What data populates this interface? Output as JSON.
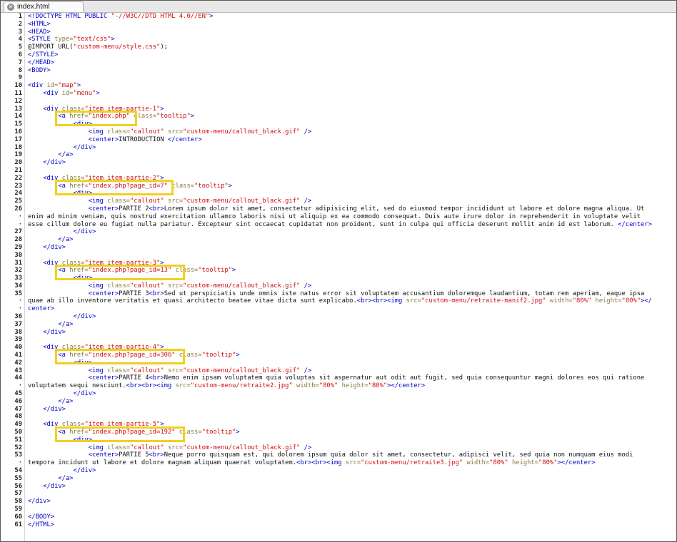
{
  "tab": {
    "label": "index.html",
    "close_icon": "close-circle-icon"
  },
  "colors": {
    "tag": "#0000c8",
    "attribute": "#8a7a3c",
    "string": "#d01010",
    "highlight": "#f0d020"
  },
  "lines": [
    {
      "n": "1",
      "c": [
        [
          "t",
          "<!DOCTYPE HTML PUBLIC "
        ],
        [
          "s",
          "\"-//W3C//DTD HTML 4.0//EN\""
        ],
        [
          "t",
          ">"
        ]
      ]
    },
    {
      "n": "2",
      "c": [
        [
          "t",
          "<HTML>"
        ]
      ]
    },
    {
      "n": "3",
      "c": [
        [
          "t",
          "<HEAD>"
        ]
      ]
    },
    {
      "n": "4",
      "c": [
        [
          "t",
          "<STYLE "
        ],
        [
          "a",
          "type="
        ],
        [
          "s",
          "\"text/css\""
        ],
        [
          "t",
          ">"
        ]
      ]
    },
    {
      "n": "5",
      "c": [
        [
          "x",
          "@IMPORT URL("
        ],
        [
          "s",
          "\"custom-menu/style.css\""
        ],
        [
          "x",
          ");"
        ]
      ]
    },
    {
      "n": "6",
      "c": [
        [
          "t",
          "</STYLE>"
        ]
      ]
    },
    {
      "n": "7",
      "c": [
        [
          "t",
          "</HEAD>"
        ]
      ]
    },
    {
      "n": "8",
      "c": [
        [
          "t",
          "<BODY>"
        ]
      ]
    },
    {
      "n": "9",
      "c": []
    },
    {
      "n": "10",
      "c": [
        [
          "t",
          "<div "
        ],
        [
          "a",
          "id="
        ],
        [
          "s",
          "\"map\""
        ],
        [
          "t",
          ">"
        ]
      ]
    },
    {
      "n": "11",
      "c": [
        [
          "x",
          "    "
        ],
        [
          "t",
          "<div "
        ],
        [
          "a",
          "id="
        ],
        [
          "s",
          "\"menu\""
        ],
        [
          "t",
          ">"
        ]
      ]
    },
    {
      "n": "12",
      "c": []
    },
    {
      "n": "13",
      "c": [
        [
          "x",
          "    "
        ],
        [
          "t",
          "<div "
        ],
        [
          "a",
          "class="
        ],
        [
          "s",
          "\"item item-partie-1\""
        ],
        [
          "t",
          ">"
        ]
      ]
    },
    {
      "n": "14",
      "c": [
        [
          "x",
          "        "
        ],
        [
          "t",
          "<a "
        ],
        [
          "a",
          "href="
        ],
        [
          "s",
          "\"index.php\""
        ],
        [
          "x",
          " "
        ],
        [
          "a",
          "class="
        ],
        [
          "s",
          "\"tooltip\""
        ],
        [
          "t",
          ">"
        ]
      ]
    },
    {
      "n": "15",
      "c": [
        [
          "x",
          "            "
        ],
        [
          "t",
          "<div>"
        ]
      ]
    },
    {
      "n": "16",
      "c": [
        [
          "x",
          "                "
        ],
        [
          "t",
          "<img "
        ],
        [
          "a",
          "class="
        ],
        [
          "s",
          "\"callout\""
        ],
        [
          "x",
          " "
        ],
        [
          "a",
          "src="
        ],
        [
          "s",
          "\"custom-menu/callout_black.gif\""
        ],
        [
          "x",
          " "
        ],
        [
          "t",
          "/>"
        ]
      ]
    },
    {
      "n": "17",
      "c": [
        [
          "x",
          "                "
        ],
        [
          "t",
          "<center>"
        ],
        [
          "x",
          "INTRODUCTION "
        ],
        [
          "t",
          "</center>"
        ]
      ]
    },
    {
      "n": "18",
      "c": [
        [
          "x",
          "            "
        ],
        [
          "t",
          "</div>"
        ]
      ]
    },
    {
      "n": "19",
      "c": [
        [
          "x",
          "        "
        ],
        [
          "t",
          "</a>"
        ]
      ]
    },
    {
      "n": "20",
      "c": [
        [
          "x",
          "    "
        ],
        [
          "t",
          "</div>"
        ]
      ]
    },
    {
      "n": "21",
      "c": []
    },
    {
      "n": "22",
      "c": [
        [
          "x",
          "    "
        ],
        [
          "t",
          "<div "
        ],
        [
          "a",
          "class="
        ],
        [
          "s",
          "\"item item-partie-2\""
        ],
        [
          "t",
          ">"
        ]
      ]
    },
    {
      "n": "23",
      "c": [
        [
          "x",
          "        "
        ],
        [
          "t",
          "<a "
        ],
        [
          "a",
          "href="
        ],
        [
          "s",
          "\"index.php?page_id=7\""
        ],
        [
          "x",
          " "
        ],
        [
          "a",
          "class="
        ],
        [
          "s",
          "\"tooltip\""
        ],
        [
          "t",
          ">"
        ]
      ]
    },
    {
      "n": "24",
      "c": [
        [
          "x",
          "            "
        ],
        [
          "t",
          "<div>"
        ]
      ]
    },
    {
      "n": "25",
      "c": [
        [
          "x",
          "                "
        ],
        [
          "t",
          "<img "
        ],
        [
          "a",
          "class="
        ],
        [
          "s",
          "\"callout\""
        ],
        [
          "x",
          " "
        ],
        [
          "a",
          "src="
        ],
        [
          "s",
          "\"custom-menu/callout_black.gif\""
        ],
        [
          "x",
          " "
        ],
        [
          "t",
          "/>"
        ]
      ]
    },
    {
      "n": "26",
      "c": [
        [
          "x",
          "                "
        ],
        [
          "t",
          "<center>"
        ],
        [
          "x",
          "PARTIE 2"
        ],
        [
          "t",
          "<br>"
        ],
        [
          "x",
          "Lorem ipsum dolor sit amet, consectetur adipisicing elit, sed do eiusmod tempor incididunt ut labore et dolore magna aliqua. Ut"
        ]
      ]
    },
    {
      "n": "·",
      "c": [
        [
          "x",
          "enim ad minim veniam, quis nostrud exercitation ullamco laboris nisi ut aliquip ex ea commodo consequat. Duis aute irure dolor in reprehenderit in voluptate velit"
        ]
      ]
    },
    {
      "n": "·",
      "c": [
        [
          "x",
          "esse cillum dolore eu fugiat nulla pariatur. Excepteur sint occaecat cupidatat non proident, sunt in culpa qui officia deserunt mollit anim id est laborum. "
        ],
        [
          "t",
          "</center>"
        ]
      ]
    },
    {
      "n": "27",
      "c": [
        [
          "x",
          "            "
        ],
        [
          "t",
          "</div>"
        ]
      ]
    },
    {
      "n": "28",
      "c": [
        [
          "x",
          "        "
        ],
        [
          "t",
          "</a>"
        ]
      ]
    },
    {
      "n": "29",
      "c": [
        [
          "x",
          "    "
        ],
        [
          "t",
          "</div>"
        ]
      ]
    },
    {
      "n": "30",
      "c": []
    },
    {
      "n": "31",
      "c": [
        [
          "x",
          "    "
        ],
        [
          "t",
          "<div "
        ],
        [
          "a",
          "class="
        ],
        [
          "s",
          "\"item item-partie-3\""
        ],
        [
          "t",
          ">"
        ]
      ]
    },
    {
      "n": "32",
      "c": [
        [
          "x",
          "        "
        ],
        [
          "t",
          "<a "
        ],
        [
          "a",
          "href="
        ],
        [
          "s",
          "\"index.php?page_id=13\""
        ],
        [
          "x",
          " "
        ],
        [
          "a",
          "class="
        ],
        [
          "s",
          "\"tooltip\""
        ],
        [
          "t",
          ">"
        ]
      ]
    },
    {
      "n": "33",
      "c": [
        [
          "x",
          "            "
        ],
        [
          "t",
          "<div>"
        ]
      ]
    },
    {
      "n": "34",
      "c": [
        [
          "x",
          "                "
        ],
        [
          "t",
          "<img "
        ],
        [
          "a",
          "class="
        ],
        [
          "s",
          "\"callout\""
        ],
        [
          "x",
          " "
        ],
        [
          "a",
          "src="
        ],
        [
          "s",
          "\"custom-menu/callout_black.gif\""
        ],
        [
          "x",
          " "
        ],
        [
          "t",
          "/>"
        ]
      ]
    },
    {
      "n": "35",
      "c": [
        [
          "x",
          "                "
        ],
        [
          "t",
          "<center>"
        ],
        [
          "x",
          "PARTIE 3"
        ],
        [
          "t",
          "<br>"
        ],
        [
          "x",
          "Sed ut perspiciatis unde omnis iste natus error sit voluptatem accusantium doloremque laudantium, totam rem aperiam, eaque ipsa"
        ]
      ]
    },
    {
      "n": "·",
      "c": [
        [
          "x",
          "quae ab illo inventore veritatis et quasi architecto beatae vitae dicta sunt explicabo."
        ],
        [
          "t",
          "<br><br><img "
        ],
        [
          "a",
          "src="
        ],
        [
          "s",
          "\"custom-menu/retraite-manif2.jpg\""
        ],
        [
          "x",
          " "
        ],
        [
          "a",
          "width="
        ],
        [
          "s",
          "\"80%\""
        ],
        [
          "x",
          " "
        ],
        [
          "a",
          "height="
        ],
        [
          "s",
          "\"80%\""
        ],
        [
          "t",
          "></"
        ]
      ]
    },
    {
      "n": "·",
      "c": [
        [
          "t",
          "center>"
        ]
      ]
    },
    {
      "n": "36",
      "c": [
        [
          "x",
          "            "
        ],
        [
          "t",
          "</div>"
        ]
      ]
    },
    {
      "n": "37",
      "c": [
        [
          "x",
          "        "
        ],
        [
          "t",
          "</a>"
        ]
      ]
    },
    {
      "n": "38",
      "c": [
        [
          "x",
          "    "
        ],
        [
          "t",
          "</div>"
        ]
      ]
    },
    {
      "n": "39",
      "c": []
    },
    {
      "n": "40",
      "c": [
        [
          "x",
          "    "
        ],
        [
          "t",
          "<div "
        ],
        [
          "a",
          "class="
        ],
        [
          "s",
          "\"item item-partie-4\""
        ],
        [
          "t",
          ">"
        ]
      ]
    },
    {
      "n": "41",
      "c": [
        [
          "x",
          "        "
        ],
        [
          "t",
          "<a "
        ],
        [
          "a",
          "href="
        ],
        [
          "s",
          "\"index.php?page_id=306\""
        ],
        [
          "x",
          " "
        ],
        [
          "a",
          "class="
        ],
        [
          "s",
          "\"tooltip\""
        ],
        [
          "t",
          ">"
        ]
      ]
    },
    {
      "n": "42",
      "c": [
        [
          "x",
          "            "
        ],
        [
          "t",
          "<div>"
        ]
      ]
    },
    {
      "n": "43",
      "c": [
        [
          "x",
          "                "
        ],
        [
          "t",
          "<img "
        ],
        [
          "a",
          "class="
        ],
        [
          "s",
          "\"callout\""
        ],
        [
          "x",
          " "
        ],
        [
          "a",
          "src="
        ],
        [
          "s",
          "\"custom-menu/callout_black.gif\""
        ],
        [
          "x",
          " "
        ],
        [
          "t",
          "/>"
        ]
      ]
    },
    {
      "n": "44",
      "c": [
        [
          "x",
          "                "
        ],
        [
          "t",
          "<center>"
        ],
        [
          "x",
          "PARTIE 4"
        ],
        [
          "t",
          "<br>"
        ],
        [
          "x",
          "Nemo enim ipsam voluptatem quia voluptas sit aspernatur aut odit aut fugit, sed quia consequuntur magni dolores eos qui ratione"
        ]
      ]
    },
    {
      "n": "·",
      "c": [
        [
          "x",
          "voluptatem sequi nesciunt."
        ],
        [
          "t",
          "<br><br><img "
        ],
        [
          "a",
          "src="
        ],
        [
          "s",
          "\"custom-menu/retraite2.jpg\""
        ],
        [
          "x",
          " "
        ],
        [
          "a",
          "width="
        ],
        [
          "s",
          "\"80%\""
        ],
        [
          "x",
          " "
        ],
        [
          "a",
          "height="
        ],
        [
          "s",
          "\"80%\""
        ],
        [
          "t",
          "></center>"
        ]
      ]
    },
    {
      "n": "45",
      "c": [
        [
          "x",
          "            "
        ],
        [
          "t",
          "</div>"
        ]
      ]
    },
    {
      "n": "46",
      "c": [
        [
          "x",
          "        "
        ],
        [
          "t",
          "</a>"
        ]
      ]
    },
    {
      "n": "47",
      "c": [
        [
          "x",
          "    "
        ],
        [
          "t",
          "</div>"
        ]
      ]
    },
    {
      "n": "48",
      "c": []
    },
    {
      "n": "49",
      "c": [
        [
          "x",
          "    "
        ],
        [
          "t",
          "<div "
        ],
        [
          "a",
          "class="
        ],
        [
          "s",
          "\"item item-partie-5\""
        ],
        [
          "t",
          ">"
        ]
      ]
    },
    {
      "n": "50",
      "c": [
        [
          "x",
          "        "
        ],
        [
          "t",
          "<a "
        ],
        [
          "a",
          "href="
        ],
        [
          "s",
          "\"index.php?page_id=192\""
        ],
        [
          "x",
          " "
        ],
        [
          "a",
          "class="
        ],
        [
          "s",
          "\"tooltip\""
        ],
        [
          "t",
          ">"
        ]
      ]
    },
    {
      "n": "51",
      "c": [
        [
          "x",
          "            "
        ],
        [
          "t",
          "<div>"
        ]
      ]
    },
    {
      "n": "52",
      "c": [
        [
          "x",
          "                "
        ],
        [
          "t",
          "<img "
        ],
        [
          "a",
          "class="
        ],
        [
          "s",
          "\"callout\""
        ],
        [
          "x",
          " "
        ],
        [
          "a",
          "src="
        ],
        [
          "s",
          "\"custom-menu/callout_black.gif\""
        ],
        [
          "x",
          " "
        ],
        [
          "t",
          "/>"
        ]
      ]
    },
    {
      "n": "53",
      "c": [
        [
          "x",
          "                "
        ],
        [
          "t",
          "<center>"
        ],
        [
          "x",
          "PARTIE 5"
        ],
        [
          "t",
          "<br>"
        ],
        [
          "x",
          "Neque porro quisquam est, qui dolorem ipsum quia dolor sit amet, consectetur, adipisci velit, sed quia non numquam eius modi"
        ]
      ]
    },
    {
      "n": "·",
      "c": [
        [
          "x",
          "tempora incidunt ut labore et dolore magnam aliquam quaerat voluptatem."
        ],
        [
          "t",
          "<br><br><img "
        ],
        [
          "a",
          "src="
        ],
        [
          "s",
          "\"custom-menu/retraite3.jpg\""
        ],
        [
          "x",
          " "
        ],
        [
          "a",
          "width="
        ],
        [
          "s",
          "\"80%\""
        ],
        [
          "x",
          " "
        ],
        [
          "a",
          "height="
        ],
        [
          "s",
          "\"80%\""
        ],
        [
          "t",
          "></center>"
        ]
      ]
    },
    {
      "n": "54",
      "c": [
        [
          "x",
          "            "
        ],
        [
          "t",
          "</div>"
        ]
      ]
    },
    {
      "n": "55",
      "c": [
        [
          "x",
          "        "
        ],
        [
          "t",
          "</a>"
        ]
      ]
    },
    {
      "n": "56",
      "c": [
        [
          "x",
          "    "
        ],
        [
          "t",
          "</div>"
        ]
      ]
    },
    {
      "n": "57",
      "c": []
    },
    {
      "n": "58",
      "c": [
        [
          "t",
          "</div>"
        ]
      ]
    },
    {
      "n": "59",
      "c": []
    },
    {
      "n": "60",
      "c": [
        [
          "t",
          "</BODY>"
        ]
      ]
    },
    {
      "n": "61",
      "c": [
        [
          "t",
          "</HTML>"
        ]
      ]
    }
  ]
}
